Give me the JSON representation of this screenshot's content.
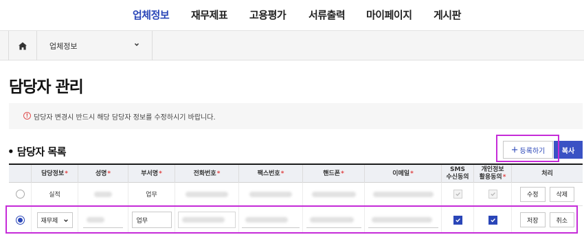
{
  "nav": {
    "items": [
      {
        "label": "업체정보",
        "active": true
      },
      {
        "label": "재무제표",
        "active": false
      },
      {
        "label": "고용평가",
        "active": false
      },
      {
        "label": "서류출력",
        "active": false
      },
      {
        "label": "마이페이지",
        "active": false
      },
      {
        "label": "게시판",
        "active": false
      }
    ]
  },
  "breadcrumb": {
    "home_icon": "home-icon",
    "selected": "업체정보",
    "dropdown_icon": "chevron-down-icon"
  },
  "page": {
    "title": "담당자 관리",
    "notice": "담당자 변경시 반드시 해당 담당자 정보를 수정하시기 바랍니다.",
    "notice_icon": "info-icon"
  },
  "section": {
    "title": "• 담당자 목록",
    "register_button": "등록하기",
    "register_icon": "plus",
    "copy_button": "복사"
  },
  "table": {
    "columns": [
      {
        "label": "",
        "required": false
      },
      {
        "label": "담당정보",
        "required": true
      },
      {
        "label": "성명",
        "required": true
      },
      {
        "label": "부서명",
        "required": true
      },
      {
        "label": "전화번호",
        "required": true
      },
      {
        "label": "팩스번호",
        "required": true
      },
      {
        "label": "핸드폰",
        "required": true
      },
      {
        "label": "이메일",
        "required": true
      },
      {
        "label": "SMS 수신동의",
        "required": false
      },
      {
        "label": "개인정보 활용동의",
        "required": true
      },
      {
        "label": "처리",
        "required": false
      }
    ],
    "required_mark": "*",
    "rows": [
      {
        "selected": false,
        "type": "실적",
        "dept": "업무",
        "sms": true,
        "privacy": true,
        "edit": "수정",
        "delete": "삭제"
      },
      {
        "selected": true,
        "type_select": "재무제",
        "dept_input": "업무",
        "sms": true,
        "privacy": true,
        "save": "저장",
        "cancel": "취소"
      }
    ]
  },
  "colors": {
    "accent": "#2a46b8",
    "primary_button": "#3a52c4",
    "highlight": "#c52ad8",
    "required": "#e04040"
  }
}
